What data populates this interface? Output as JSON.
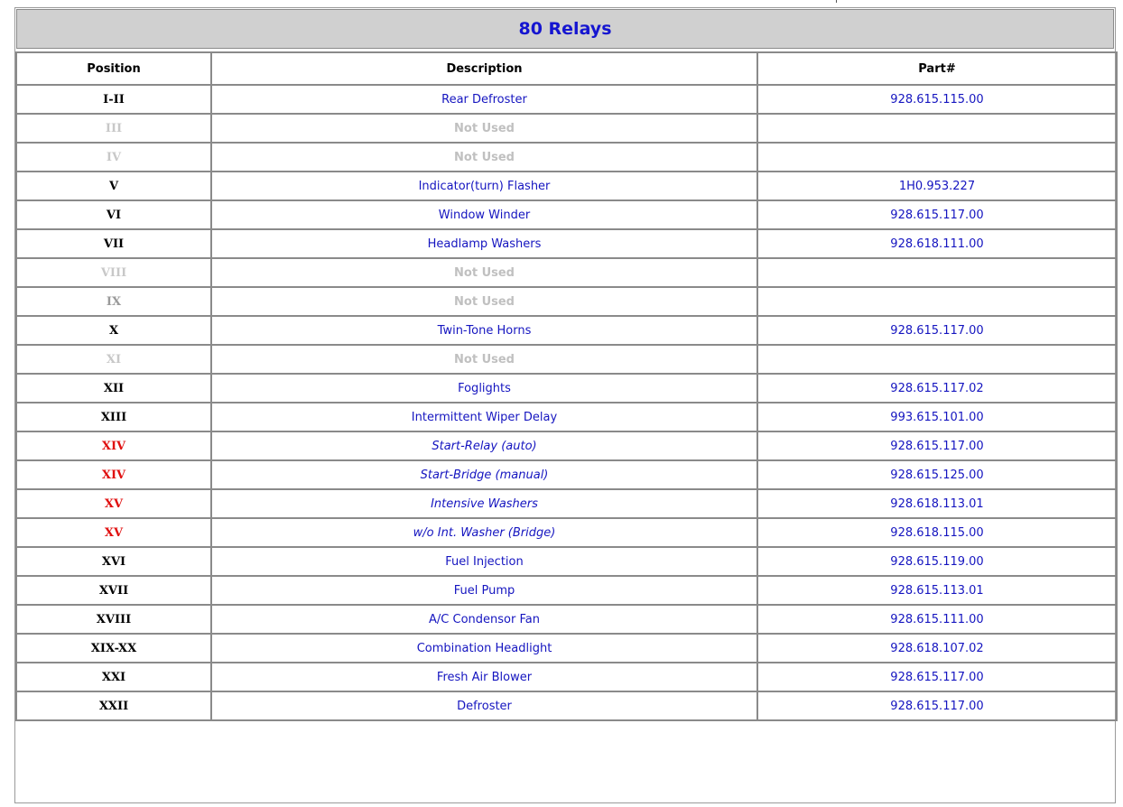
{
  "title": "80 Relays",
  "columns": [
    "Position",
    "Description",
    "Part#"
  ],
  "colors": {
    "link_blue": "#1515c0",
    "highlight_red": "#e01010",
    "unused_grey": "#c0c0c0",
    "header_bg": "#d0d0d0"
  },
  "rows": [
    {
      "position": "I-II",
      "description": "Rear Defroster",
      "part": "928.615.115.00",
      "style": "normal"
    },
    {
      "position": "III",
      "description": "Not Used",
      "part": "",
      "style": "unused"
    },
    {
      "position": "IV",
      "description": "Not Used",
      "part": "",
      "style": "unused"
    },
    {
      "position": "V",
      "description": "Indicator(turn) Flasher",
      "part": "1H0.953.227",
      "style": "normal"
    },
    {
      "position": "VI",
      "description": "Window Winder",
      "part": "928.615.117.00",
      "style": "normal"
    },
    {
      "position": "VII",
      "description": "Headlamp Washers",
      "part": "928.618.111.00",
      "style": "normal"
    },
    {
      "position": "VIII",
      "description": "Not Used",
      "part": "",
      "style": "unused"
    },
    {
      "position": "IX",
      "description": "Not Used",
      "part": "",
      "style": "unused-mid"
    },
    {
      "position": "X",
      "description": "Twin-Tone Horns",
      "part": "928.615.117.00",
      "style": "normal"
    },
    {
      "position": "XI",
      "description": "Not Used",
      "part": "",
      "style": "unused"
    },
    {
      "position": "XII",
      "description": "Foglights",
      "part": "928.615.117.02",
      "style": "normal"
    },
    {
      "position": "XIII",
      "description": "Intermittent Wiper Delay",
      "part": "993.615.101.00",
      "style": "normal"
    },
    {
      "position": "XIV",
      "description": "Start-Relay (auto)",
      "part": "928.615.117.00",
      "style": "red"
    },
    {
      "position": "XIV",
      "description": "Start-Bridge (manual)",
      "part": "928.615.125.00",
      "style": "red"
    },
    {
      "position": "XV",
      "description": "Intensive Washers",
      "part": "928.618.113.01",
      "style": "red"
    },
    {
      "position": "XV",
      "description": "w/o Int. Washer (Bridge)",
      "part": "928.618.115.00",
      "style": "red"
    },
    {
      "position": "XVI",
      "description": "Fuel Injection",
      "part": "928.615.119.00",
      "style": "normal"
    },
    {
      "position": "XVII",
      "description": "Fuel Pump",
      "part": "928.615.113.01",
      "style": "normal"
    },
    {
      "position": "XVIII",
      "description": "A/C Condensor Fan",
      "part": "928.615.111.00",
      "style": "normal"
    },
    {
      "position": "XIX-XX",
      "description": "Combination Headlight",
      "part": "928.618.107.02",
      "style": "normal"
    },
    {
      "position": "XXI",
      "description": "Fresh Air Blower",
      "part": "928.615.117.00",
      "style": "normal"
    },
    {
      "position": "XXII",
      "description": "Defroster",
      "part": "928.615.117.00",
      "style": "normal"
    }
  ]
}
